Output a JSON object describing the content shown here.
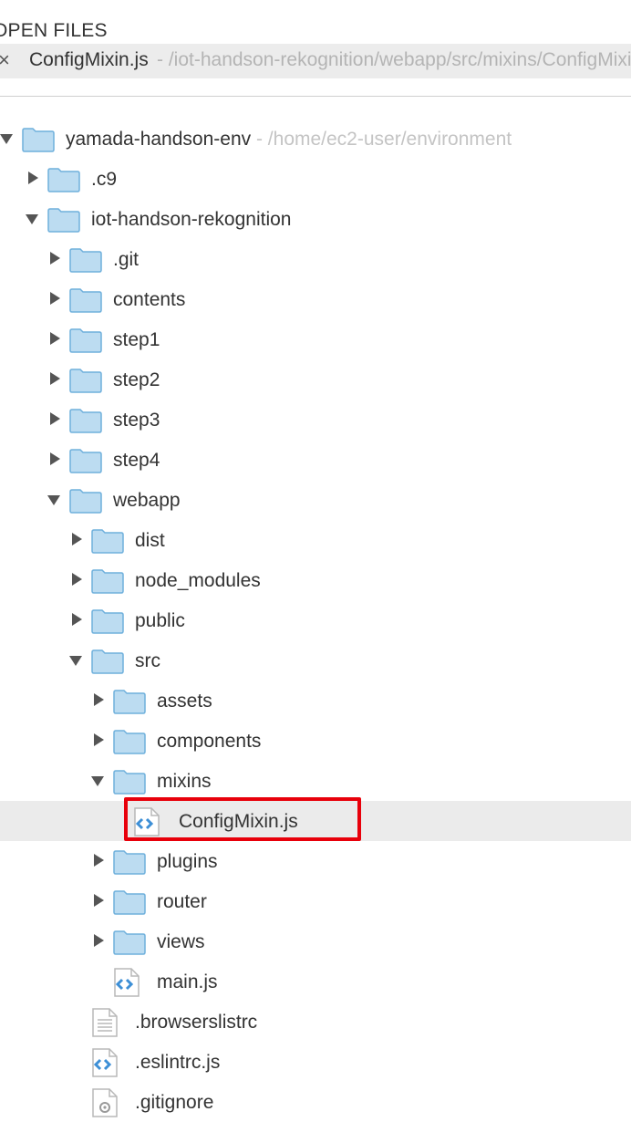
{
  "open_files": {
    "header": "OPEN FILES",
    "close_glyph": "×",
    "file": {
      "name": "ConfigMixin.js",
      "path": " - /iot-handson-rekognition/webapp/src/mixins/ConfigMixin.js"
    }
  },
  "tree": {
    "root": {
      "name": "yamada-handson-env",
      "path": " - /home/ec2-user/environment"
    },
    "items": [
      {
        "name": ".c9"
      },
      {
        "name": "iot-handson-rekognition"
      },
      {
        "name": ".git"
      },
      {
        "name": "contents"
      },
      {
        "name": "step1"
      },
      {
        "name": "step2"
      },
      {
        "name": "step3"
      },
      {
        "name": "step4"
      },
      {
        "name": "webapp"
      },
      {
        "name": "dist"
      },
      {
        "name": "node_modules"
      },
      {
        "name": "public"
      },
      {
        "name": "src"
      },
      {
        "name": "assets"
      },
      {
        "name": "components"
      },
      {
        "name": "mixins"
      },
      {
        "name": "ConfigMixin.js"
      },
      {
        "name": "plugins"
      },
      {
        "name": "router"
      },
      {
        "name": "views"
      },
      {
        "name": "main.js"
      },
      {
        "name": ".browserslistrc"
      },
      {
        "name": ".eslintrc.js"
      },
      {
        "name": ".gitignore"
      }
    ]
  },
  "colors": {
    "folder_fill": "#bcdcf1",
    "folder_stroke": "#6fb0dc",
    "highlight": "#e8000b",
    "selected_row": "#ebebeb"
  }
}
